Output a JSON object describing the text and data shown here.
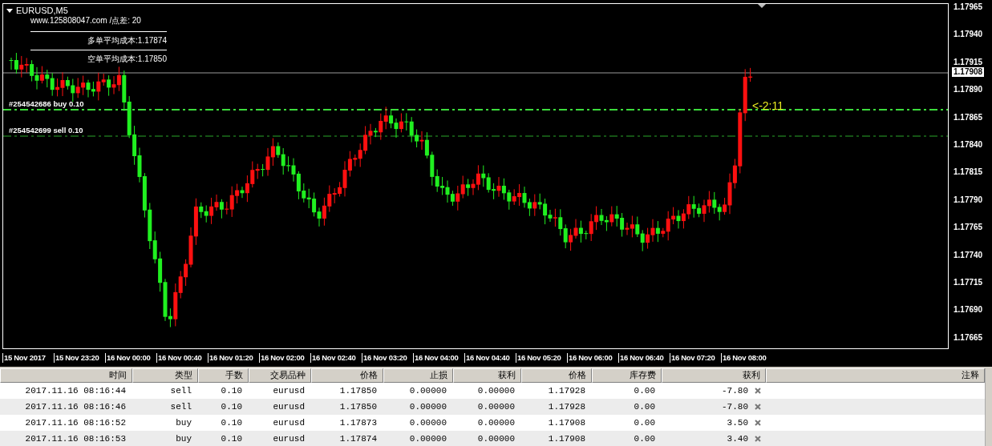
{
  "chart": {
    "title": "EURUSD,M5",
    "info": {
      "site": "www.125808047.com",
      "spread_label": "/点差:",
      "spread": "20",
      "lines": [
        {
          "label": "多单平均成本:",
          "value": "1.17874"
        },
        {
          "label": "空单平均成本:",
          "value": "1.17850"
        }
      ]
    },
    "orders": [
      {
        "kind": "buy",
        "label": "#254542686 buy 0.10"
      },
      {
        "kind": "sell",
        "label": "#254542699 sell 0.10"
      }
    ],
    "countdown": "<-2:11",
    "price_axis": [
      "1.17965",
      "1.17940",
      "1.17915",
      "1.17890",
      "1.17865",
      "1.17840",
      "1.17815",
      "1.17790",
      "1.17765",
      "1.17740",
      "1.17715",
      "1.17690",
      "1.17665"
    ],
    "current_price": "1.17908",
    "time_axis": [
      "15 Nov 2017",
      "15 Nov 23:20",
      "16 Nov 00:00",
      "16 Nov 00:40",
      "16 Nov 01:20",
      "16 Nov 02:00",
      "16 Nov 02:40",
      "16 Nov 03:20",
      "16 Nov 04:00",
      "16 Nov 04:40",
      "16 Nov 05:20",
      "16 Nov 06:00",
      "16 Nov 06:40",
      "16 Nov 07:20",
      "16 Nov 08:00"
    ]
  },
  "table": {
    "columns": [
      "时间",
      "类型",
      "手数",
      "交易品种",
      "价格",
      "止损",
      "获利",
      "价格",
      "库存费",
      "获利",
      "注释"
    ],
    "rows": [
      {
        "cells": [
          "2017.11.16 08:16:44",
          "sell",
          "0.10",
          "eurusd",
          "1.17850",
          "0.00000",
          "0.00000",
          "1.17928",
          "0.00",
          "-7.80"
        ]
      },
      {
        "cells": [
          "2017.11.16 08:16:46",
          "sell",
          "0.10",
          "eurusd",
          "1.17850",
          "0.00000",
          "0.00000",
          "1.17928",
          "0.00",
          "-7.80"
        ]
      },
      {
        "cells": [
          "2017.11.16 08:16:52",
          "buy",
          "0.10",
          "eurusd",
          "1.17873",
          "0.00000",
          "0.00000",
          "1.17908",
          "0.00",
          "3.50"
        ]
      },
      {
        "cells": [
          "2017.11.16 08:16:53",
          "buy",
          "0.10",
          "eurusd",
          "1.17874",
          "0.00000",
          "0.00000",
          "1.17908",
          "0.00",
          "3.40"
        ]
      }
    ]
  }
}
